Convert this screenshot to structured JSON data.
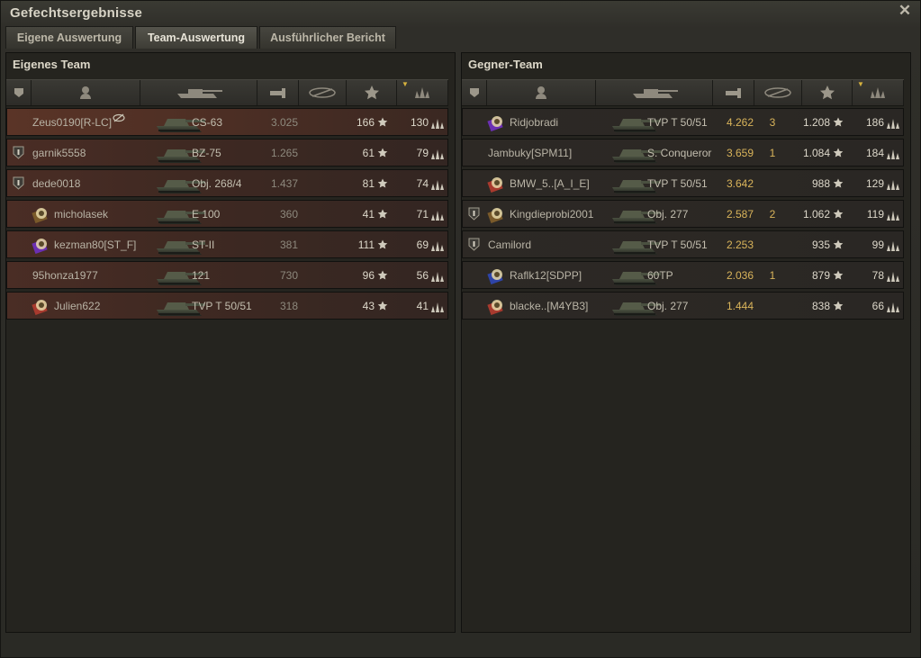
{
  "window": {
    "title": "Gefechtsergebnisse",
    "close_icon": "close-icon"
  },
  "tabs": [
    {
      "label": "Eigene Auswertung",
      "active": false
    },
    {
      "label": "Team-Auswertung",
      "active": true
    },
    {
      "label": "Ausführlicher Bericht",
      "active": false
    }
  ],
  "own_team": {
    "title": "Eigenes Team",
    "columns": [
      "squad-icon",
      "player-icon",
      "tank-icon",
      "damage-icon",
      "spotted-icon",
      "xp-star-icon",
      "medal-icon"
    ],
    "rows": [
      {
        "player": "Zeus0190[R-LC]",
        "vehicle": "CS-63",
        "rating": "3.025",
        "spotted": "",
        "xp": "166",
        "credits": "130",
        "self": true,
        "squad": false,
        "clan": false
      },
      {
        "player": "garnik5558",
        "vehicle": "BZ-75",
        "rating": "1.265",
        "spotted": "",
        "xp": "61",
        "credits": "79",
        "squad": true,
        "clan": false
      },
      {
        "player": "dede0018",
        "vehicle": "Obj. 268/4",
        "rating": "1.437",
        "spotted": "",
        "xp": "81",
        "credits": "74",
        "squad": true,
        "clan": false
      },
      {
        "player": "micholasek",
        "vehicle": "E 100",
        "rating": "360",
        "spotted": "",
        "xp": "41",
        "credits": "71",
        "squad": false,
        "clan": true
      },
      {
        "player": "kezman80[ST_F]",
        "vehicle": "ST-II",
        "rating": "381",
        "spotted": "",
        "xp": "111",
        "credits": "69",
        "squad": false,
        "clan": true
      },
      {
        "player": "95honza1977",
        "vehicle": "121",
        "rating": "730",
        "spotted": "",
        "xp": "96",
        "credits": "56",
        "squad": false,
        "clan": false
      },
      {
        "player": "Julien622",
        "vehicle": "TVP T 50/51",
        "rating": "318",
        "spotted": "",
        "xp": "43",
        "credits": "41",
        "squad": false,
        "clan": true
      }
    ]
  },
  "enemy_team": {
    "title": "Gegner-Team",
    "columns": [
      "squad-icon",
      "player-icon",
      "tank-icon",
      "damage-icon",
      "spotted-icon",
      "xp-star-icon",
      "medal-icon"
    ],
    "rows": [
      {
        "player": "Ridjobradi",
        "vehicle": "TVP T 50/51",
        "rating": "4.262",
        "spotted": "3",
        "xp": "1.208",
        "credits": "186",
        "squad": false,
        "clan": true
      },
      {
        "player": "Jambuky[SPM11]",
        "vehicle": "S. Conqueror",
        "rating": "3.659",
        "spotted": "1",
        "xp": "1.084",
        "credits": "184",
        "squad": false,
        "clan": false
      },
      {
        "player": "BMW_5..[A_I_E]",
        "vehicle": "TVP T 50/51",
        "rating": "3.642",
        "spotted": "",
        "xp": "988",
        "credits": "129",
        "squad": false,
        "clan": true
      },
      {
        "player": "Kingdieprobi2001",
        "vehicle": "Obj. 277",
        "rating": "2.587",
        "spotted": "2",
        "xp": "1.062",
        "credits": "119",
        "squad": true,
        "clan": true
      },
      {
        "player": "Camilord",
        "vehicle": "TVP T 50/51",
        "rating": "2.253",
        "spotted": "",
        "xp": "935",
        "credits": "99",
        "squad": true,
        "clan": false
      },
      {
        "player": "Raflk12[SDPP]",
        "vehicle": "60TP",
        "rating": "2.036",
        "spotted": "1",
        "xp": "879",
        "credits": "78",
        "squad": false,
        "clan": true
      },
      {
        "player": "blacke..[M4YB3]",
        "vehicle": "Obj. 277",
        "rating": "1.444",
        "spotted": "",
        "xp": "838",
        "credits": "66",
        "squad": false,
        "clan": true
      }
    ]
  },
  "colors": {
    "highlight": "#d9b45a",
    "own_team_row": "#4a2d25",
    "enemy_team_row": "#2d2925"
  }
}
